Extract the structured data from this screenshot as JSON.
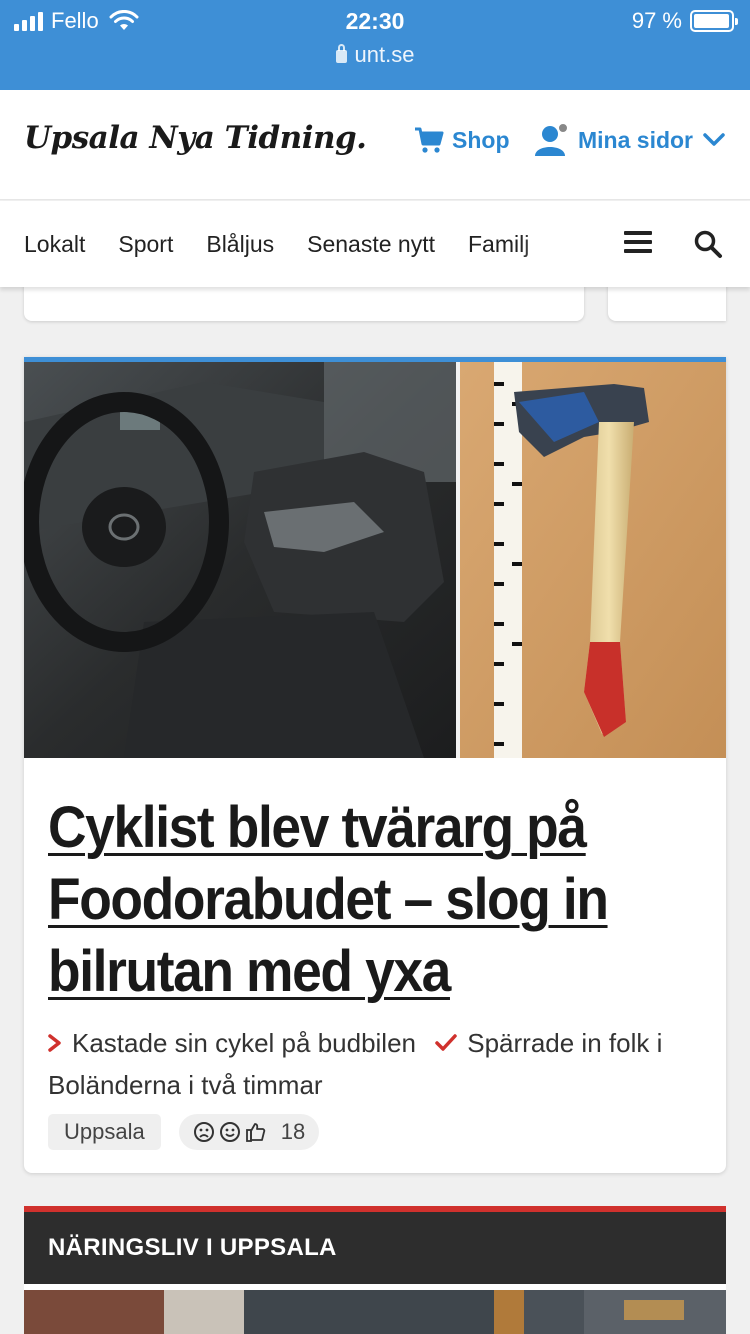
{
  "status_bar": {
    "carrier": "Fello",
    "time": "22:30",
    "battery": "97 %",
    "battery_level": 0.97,
    "url": "unt.se"
  },
  "header": {
    "logo": "Upsala Nya Tidning.",
    "shop_label": "Shop",
    "account_label": "Mina sidor",
    "accent_color": "#2b87d1"
  },
  "nav": {
    "items": [
      "Lokalt",
      "Sport",
      "Blåljus",
      "Senaste nytt",
      "Familj"
    ],
    "menu_icon": "hamburger-menu-icon",
    "search_icon": "search-icon"
  },
  "article": {
    "headline": "Cyklist blev tvärarg på Foodorabudet – slog in bilrutan med yxa",
    "bullets": [
      "Kastade sin cykel på budbilen",
      "Spärrade in folk i Boländerna i två timmar"
    ],
    "bullet_icons": [
      "chevron-right-icon",
      "checkmark-icon"
    ],
    "tag": "Uppsala",
    "reaction_icons": [
      "angry-face-icon",
      "smile-face-icon",
      "thumbs-up-icon"
    ],
    "reaction_count": "18",
    "accent_color": "#3e8fd6"
  },
  "section": {
    "title": "NÄRINGSLIV I UPPSALA",
    "accent_color": "#d0312d"
  }
}
